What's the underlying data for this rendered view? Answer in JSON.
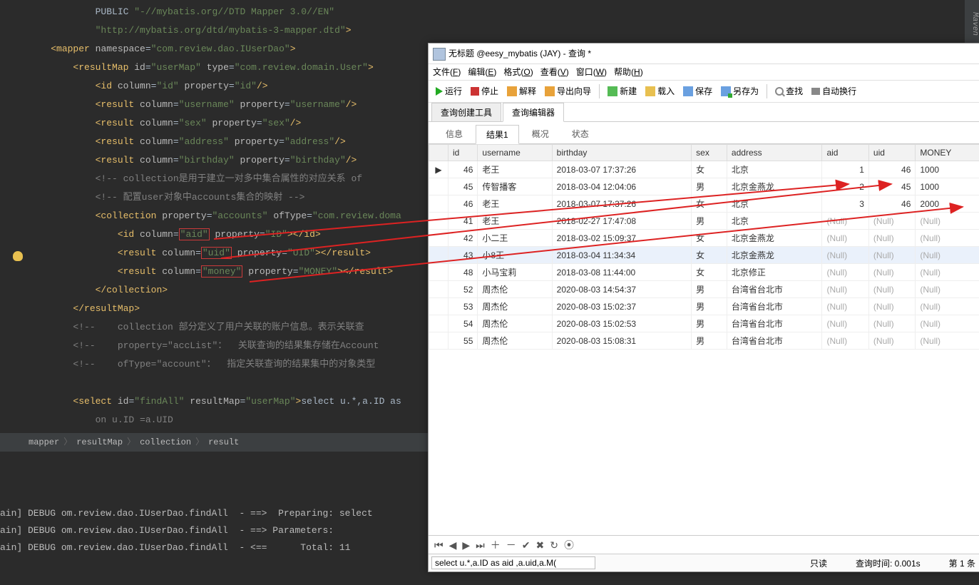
{
  "code_lines": [
    {
      "indent": 3,
      "html": "PUBLIC <span class='attr-val'>\"-//mybatis.org//DTD Mapper 3.0//EN\"</span>"
    },
    {
      "indent": 3,
      "html": "<span class='attr-val'>\"http://mybatis.org/dtd/mybatis-3-mapper.dtd\"</span><span class='tag'>&gt;</span>"
    },
    {
      "indent": 1,
      "html": "<span class='tag'>&lt;mapper</span> <span class='attr-name'>namespace</span>=<span class='attr-val'>\"com.review.dao.IUserDao\"</span><span class='tag'>&gt;</span>"
    },
    {
      "indent": 2,
      "html": "<span class='tag'>&lt;resultMap</span> <span class='attr-name'>id</span>=<span class='attr-val'>\"userMap\"</span> <span class='attr-name'>type</span>=<span class='attr-val'>\"com.review.domain.User\"</span><span class='tag'>&gt;</span>"
    },
    {
      "indent": 3,
      "html": "<span class='tag'>&lt;id</span> <span class='attr-name'>column</span>=<span class='attr-val'>\"id\"</span> <span class='attr-name'>property</span>=<span class='attr-val'>\"id\"</span><span class='tag'>/&gt;</span>"
    },
    {
      "indent": 3,
      "html": "<span class='tag'>&lt;result</span> <span class='attr-name'>column</span>=<span class='attr-val'>\"username\"</span> <span class='attr-name'>property</span>=<span class='attr-val'>\"username\"</span><span class='tag'>/&gt;</span>"
    },
    {
      "indent": 3,
      "html": "<span class='tag'>&lt;result</span> <span class='attr-name'>column</span>=<span class='attr-val'>\"sex\"</span> <span class='attr-name'>property</span>=<span class='attr-val'>\"sex\"</span><span class='tag'>/&gt;</span>"
    },
    {
      "indent": 3,
      "html": "<span class='tag'>&lt;result</span> <span class='attr-name'>column</span>=<span class='attr-val'>\"address\"</span> <span class='attr-name'>property</span>=<span class='attr-val'>\"address\"</span><span class='tag'>/&gt;</span>"
    },
    {
      "indent": 3,
      "html": "<span class='tag'>&lt;result</span> <span class='attr-name'>column</span>=<span class='attr-val'>\"birthday\"</span> <span class='attr-name'>property</span>=<span class='attr-val'>\"birthday\"</span><span class='tag'>/&gt;</span>"
    },
    {
      "indent": 3,
      "html": "<span class='comment'>&lt;!-- collection是用于建立一对多中集合属性的对应关系 of</span>"
    },
    {
      "indent": 3,
      "html": "<span class='comment'>&lt;!-- 配置user对象中accounts集合的映射 --&gt;</span>"
    },
    {
      "indent": 3,
      "html": "<span class='tag'>&lt;collection</span> <span class='attr-name'>property</span>=<span class='attr-val'>\"accounts\"</span> <span class='attr-name'>ofType</span>=<span class='attr-val'>\"com.review.doma</span>"
    },
    {
      "indent": 4,
      "html": "<span class='tag'>&lt;id</span> <span class='attr-name'>column</span>=<span class='hlbox'><span class='attr-val'>\"aid\"</span></span> <span class='attr-name'>property</span>=<span class='attr-val'>\"ID\"</span><span class='tag'>&gt;&lt;/id&gt;</span>"
    },
    {
      "indent": 4,
      "html": "<span class='tag'>&lt;result</span> <span class='attr-name'>column</span>=<span class='hlbox'><span class='attr-val'>\"uid\"</span></span> <span class='attr-name'>property</span>=<span class='attr-val'>\"UID\"</span><span class='tag'>&gt;&lt;/result&gt;</span>"
    },
    {
      "indent": 4,
      "html": "<span class='tag'>&lt;result</span> <span class='attr-name'>column</span>=<span class='hlbox'><span class='attr-val'>\"money\"</span></span> <span class='attr-name'>property</span>=<span class='attr-val'>\"MONEY\"</span><span class='tag'>&gt;&lt;/result&gt;</span>"
    },
    {
      "indent": 3,
      "html": "<span class='tag'>&lt;/collection&gt;</span>"
    },
    {
      "indent": 2,
      "html": "<span class='tag'>&lt;/resultMap&gt;</span>"
    },
    {
      "indent": 2,
      "html": "<span class='comment'>&lt;!--    collection 部分定义了用户关联的账户信息。表示关联查</span>"
    },
    {
      "indent": 2,
      "html": "<span class='comment'>&lt;!--    property=\"accList\"：  关联查询的结果集存储在Account</span>"
    },
    {
      "indent": 2,
      "html": "<span class='comment'>&lt;!--    ofType=\"account\"：  指定关联查询的结果集中的对象类型</span>"
    },
    {
      "indent": 2,
      "html": ""
    },
    {
      "indent": 2,
      "html": "<span class='tag'>&lt;select</span> <span class='attr-name'>id</span>=<span class='attr-val'>\"findAll\"</span> <span class='attr-name'>resultMap</span>=<span class='attr-val'>\"userMap\"</span><span class='tag'>&gt;</span>select u.*,a.ID as"
    },
    {
      "indent": 3,
      "html": "<span class='comment'>on u.ID =a.UID</span>"
    }
  ],
  "breadcrumb": [
    "mapper",
    "resultMap",
    "collection",
    "result"
  ],
  "console_lines": [
    "ain] DEBUG om.review.dao.IUserDao.findAll  - ==>  Preparing: select",
    "ain] DEBUG om.review.dao.IUserDao.findAll  - ==> Parameters:",
    "ain] DEBUG om.review.dao.IUserDao.findAll  - <==      Total: 11"
  ],
  "db_window": {
    "title": "无标题 @eesy_mybatis (JAY) - 查询 *",
    "menus": [
      "文件(F)",
      "编辑(E)",
      "格式(O)",
      "查看(V)",
      "窗口(W)",
      "帮助(H)"
    ],
    "toolbar": [
      {
        "icon": "run",
        "label": "运行"
      },
      {
        "icon": "stop",
        "label": "停止"
      },
      {
        "icon": "gen",
        "label": "解释"
      },
      {
        "icon": "gen",
        "label": "导出向导"
      },
      {
        "sep": true
      },
      {
        "icon": "new",
        "label": "新建"
      },
      {
        "icon": "open",
        "label": "载入"
      },
      {
        "icon": "save",
        "label": "保存"
      },
      {
        "icon": "saveas",
        "label": "另存为"
      },
      {
        "sep": true
      },
      {
        "icon": "find",
        "label": "查找"
      },
      {
        "icon": "wrap",
        "label": "自动换行"
      }
    ],
    "maintabs": [
      "查询创建工具",
      "查询编辑器"
    ],
    "maintab_active": 1,
    "subtabs": [
      "信息",
      "结果1",
      "概况",
      "状态"
    ],
    "subtab_active": 1,
    "columns": [
      "",
      "id",
      "username",
      "birthday",
      "sex",
      "address",
      "aid",
      "uid",
      "MONEY"
    ],
    "rows": [
      {
        "ptr": "▶",
        "id": 46,
        "username": "老王",
        "birthday": "2018-03-07 17:37:26",
        "sex": "女",
        "address": "北京",
        "aid": "1",
        "uid": "46",
        "money": "1000"
      },
      {
        "ptr": "",
        "id": 45,
        "username": "传智播客",
        "birthday": "2018-03-04 12:04:06",
        "sex": "男",
        "address": "北京金燕龙",
        "aid": "2",
        "uid": "45",
        "money": "1000"
      },
      {
        "ptr": "",
        "id": 46,
        "username": "老王",
        "birthday": "2018-03-07 17:37:26",
        "sex": "女",
        "address": "北京",
        "aid": "3",
        "uid": "46",
        "money": "2000"
      },
      {
        "ptr": "",
        "id": 41,
        "username": "老王",
        "birthday": "2018-02-27 17:47:08",
        "sex": "男",
        "address": "北京",
        "aid": null,
        "uid": null,
        "money": null
      },
      {
        "ptr": "",
        "id": 42,
        "username": "小二王",
        "birthday": "2018-03-02 15:09:37",
        "sex": "女",
        "address": "北京金燕龙",
        "aid": null,
        "uid": null,
        "money": null
      },
      {
        "ptr": "",
        "id": 43,
        "username": "小8王",
        "birthday": "2018-03-04 11:34:34",
        "sex": "女",
        "address": "北京金燕龙",
        "aid": null,
        "uid": null,
        "money": null,
        "sel": true
      },
      {
        "ptr": "",
        "id": 48,
        "username": "小马宝莉",
        "birthday": "2018-03-08 11:44:00",
        "sex": "女",
        "address": "北京修正",
        "aid": null,
        "uid": null,
        "money": null
      },
      {
        "ptr": "",
        "id": 52,
        "username": "周杰伦",
        "birthday": "2020-08-03 14:54:37",
        "sex": "男",
        "address": "台湾省台北市",
        "aid": null,
        "uid": null,
        "money": null
      },
      {
        "ptr": "",
        "id": 53,
        "username": "周杰伦",
        "birthday": "2020-08-03 15:02:37",
        "sex": "男",
        "address": "台湾省台北市",
        "aid": null,
        "uid": null,
        "money": null
      },
      {
        "ptr": "",
        "id": 54,
        "username": "周杰伦",
        "birthday": "2020-08-03 15:02:53",
        "sex": "男",
        "address": "台湾省台北市",
        "aid": null,
        "uid": null,
        "money": null
      },
      {
        "ptr": "",
        "id": 55,
        "username": "周杰伦",
        "birthday": "2020-08-03 15:08:31",
        "sex": "男",
        "address": "台湾省台北市",
        "aid": null,
        "uid": null,
        "money": null
      }
    ],
    "sql": "select u.*,a.ID as aid ,a.uid,a.M(",
    "status_readonly": "只读",
    "status_time": "查询时间: 0.001s",
    "status_page": "第 1 条"
  },
  "maven_label": "Maven"
}
